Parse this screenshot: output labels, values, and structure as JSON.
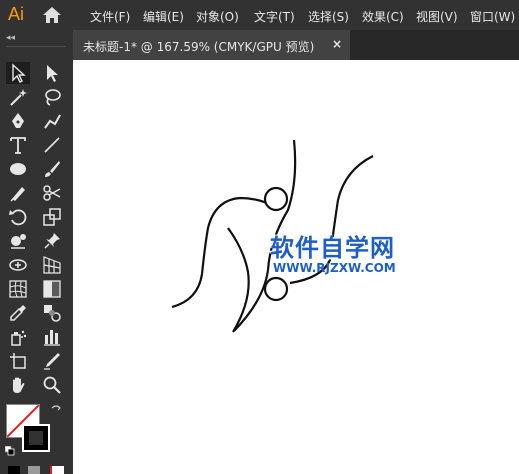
{
  "app": {
    "logo": "Ai"
  },
  "menu": [
    {
      "label": "文件(F)"
    },
    {
      "label": "编辑(E)"
    },
    {
      "label": "对象(O)"
    },
    {
      "label": "文字(T)"
    },
    {
      "label": "选择(S)"
    },
    {
      "label": "效果(C)"
    },
    {
      "label": "视图(V)"
    },
    {
      "label": "窗口(W)"
    }
  ],
  "document_tab": {
    "title": "未标题-1* @ 167.59% (CMYK/GPU 预览)",
    "close_glyph": "×"
  },
  "toolbar": {
    "collapse_glyph": "◂◂",
    "tools": [
      "selection-tool",
      "direct-selection-tool",
      "magic-wand-tool",
      "lasso-tool",
      "pen-tool",
      "curvature-tool",
      "type-tool",
      "line-segment-tool",
      "ellipse-tool",
      "paintbrush-tool",
      "shaper-tool",
      "scissors-tool",
      "rotate-tool",
      "scale-tool",
      "puppet-warp-tool",
      "pin-tool",
      "free-transform-tool",
      "perspective-grid-tool",
      "mesh-tool",
      "gradient-tool",
      "eyedropper-tool",
      "blend-tool",
      "symbol-sprayer-tool",
      "column-graph-tool",
      "artboard-tool",
      "slice-tool",
      "hand-tool",
      "zoom-tool"
    ]
  },
  "watermark": {
    "title": "软件自学网",
    "url": "WWW.RJZXW.COM"
  },
  "colors": {
    "fill": "none",
    "stroke": "#000000",
    "accent": "#ff9a00",
    "watermark": "#1e5fc7"
  }
}
